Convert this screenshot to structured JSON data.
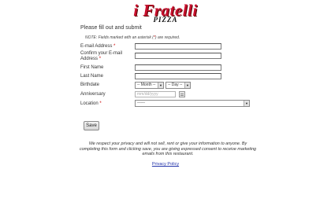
{
  "brand": {
    "name": "i Fratelli",
    "sub": "PIZZA"
  },
  "form": {
    "intro": "Please fill out and submit",
    "note_prefix": "NOTE: Fields marked with an asterisk (",
    "note_star": "*",
    "note_suffix": ") are required.",
    "fields": {
      "email": {
        "label": "E-mail Address",
        "required": "*"
      },
      "confirm_email": {
        "label_line1": "Confirm your E-mail",
        "label_line2": "Address",
        "required": "*"
      },
      "first_name": {
        "label": "First Name"
      },
      "last_name": {
        "label": "Last Name"
      },
      "birthdate": {
        "label": "Birthdate",
        "month": "-- Month --",
        "day": "-- Day --"
      },
      "anniversary": {
        "label": "Anniversary",
        "placeholder": "mm/dd/yyyy"
      },
      "location": {
        "label": "Location",
        "required": "*",
        "value": "------"
      }
    },
    "save_label": "Save",
    "disclaimer": "We respect your privacy and will not sell, rent or give your information to anyone. By completing this form and clicking save, you are giving expressed consent to receive marketing emails from this restaurant.",
    "policy_link": "Privacy Policy"
  }
}
